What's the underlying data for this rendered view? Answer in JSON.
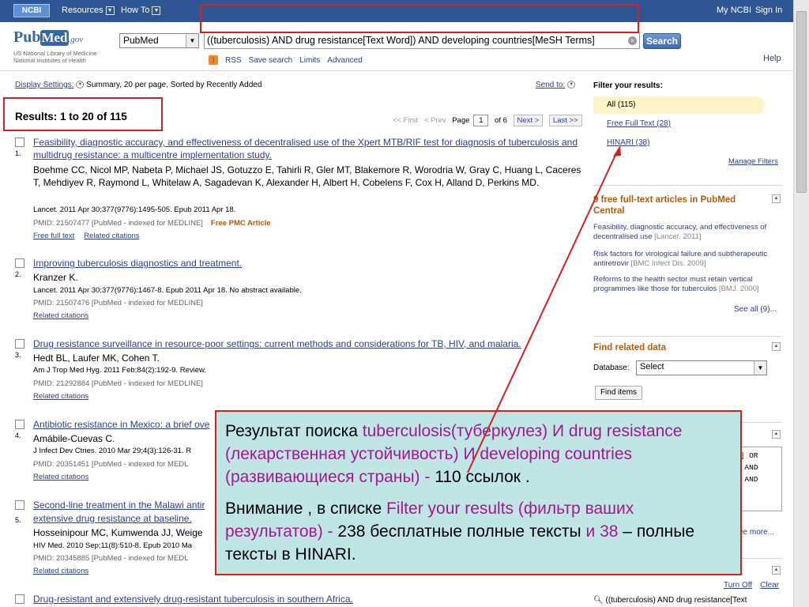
{
  "topbar": {
    "logo": "NCBI",
    "resources": "Resources",
    "howto": "How To",
    "my_ncbi": "My NCBI",
    "sign_in": "Sign In"
  },
  "header": {
    "logo_pub": "Pub",
    "logo_med": "Med",
    "logo_gov": ".gov",
    "nlm_line1": "US National Library of Medicine",
    "nlm_line2": "National Institutes of Health",
    "db_value": "PubMed",
    "search_value": "((tuberculosis) AND drug resistance[Text Word]) AND developing countries[MeSH Terms]",
    "search_button": "Search",
    "links": [
      "RSS",
      "Save search",
      "Limits",
      "Advanced"
    ],
    "help": "Help"
  },
  "display": {
    "settings_label": "Display Settings:",
    "settings_value": "Summary, 20 per page, Sorted by Recently Added",
    "send_to": "Send to:"
  },
  "results": {
    "count": "Results: 1 to 20 of 115",
    "pager": {
      "first": "<< First",
      "prev": "< Prev",
      "page_label": "Page",
      "page_value": "1",
      "of": "of 6",
      "next": "Next >",
      "last": "Last >>"
    },
    "items": [
      {
        "num": "1.",
        "title": "Feasibility, diagnostic accuracy, and effectiveness of decentralised use of the Xpert MTB/RIF test for diagnosis of tuberculosis and multidrug resistance: a multicentre implementation study.",
        "authors": "Boehme CC, Nicol MP, Nabeta P, Michael JS, Gotuzzo E, Tahirli R, Gler MT, Blakemore R, Worodria W, Gray C, Huang L, Caceres T, Mehdiyev R, Raymond L, Whitelaw A, Sagadevan K, Alexander H, Albert H, Cobelens F, Cox H, Alland D, Perkins MD.",
        "source": "Lancet. 2011 Apr 30;377(9776):1495-505. Epub 2011 Apr 18.",
        "pmid": "PMID: 21507477 [PubMed - indexed for MEDLINE]",
        "pmc": "Free PMC Article",
        "links": [
          "Free full text",
          "Related citations"
        ]
      },
      {
        "num": "2.",
        "title": "Improving tuberculosis diagnostics and treatment.",
        "authors": "Kranzer K.",
        "source": "Lancet. 2011 Apr 30;377(9776):1467-8. Epub 2011 Apr 18. No abstract available.",
        "pmid": "PMID: 21507476 [PubMed - indexed for MEDLINE]",
        "links": [
          "Related citations"
        ]
      },
      {
        "num": "3.",
        "title": "Drug resistance surveillance in resource-poor settings: current methods and considerations for TB, HIV, and malaria.",
        "authors": "Hedt BL, Laufer MK, Cohen T.",
        "source": "Am J Trop Med Hyg. 2011 Feb;84(2):192-9. Review.",
        "pmid": "PMID: 21292884 [PubMed - indexed for MEDLINE]",
        "links": [
          "Related citations"
        ]
      },
      {
        "num": "4.",
        "title": "Antibiotic resistance in Mexico: a brief ove",
        "authors": "Amábile-Cuevas C.",
        "source": "J Infect Dev Ctries. 2010 Mar 29;4(3):126-31. R",
        "pmid": "PMID: 20351451 [PubMed - indexed for MEDL",
        "links": [
          "Related citations"
        ]
      },
      {
        "num": "5.",
        "title": "Second-line treatment in the Malawi antir",
        "title2": "extensive drug resistance at baseline.",
        "authors": "Hosseinipour MC, Kumwenda JJ, Weige",
        "source": "HIV Med. 2010 Sep;11(8):510-8. Epub 2010 Ma",
        "pmid": "PMID: 20345885 [PubMed - indexed for MEDL",
        "links": [
          "Related citations"
        ]
      },
      {
        "num": "",
        "title": "Drug-resistant and extensively drug-resistant tuberculosis in southern Africa."
      }
    ]
  },
  "sidebar": {
    "filter_title": "Filter your results:",
    "filters": [
      "All (115)",
      "Free Full Text (28)",
      "HINARI (38)"
    ],
    "manage": "Manage Filters",
    "free_head": "9 free full-text articles in PubMed Central",
    "free_items": [
      {
        "title": "Feasibility, diagnostic accuracy, and effectiveness of decentralised use",
        "journal": "[Lancet. 2011]"
      },
      {
        "title": "Risk factors for virological failure and subtherapeutic antiretrovir",
        "journal": "[BMC Infect Dis. 2009]"
      },
      {
        "title": "Reforms to the health sector must retain vertical programmes like those for tuberculos",
        "journal": "[BMJ. 2000]"
      }
    ],
    "see_all": "See all (9)...",
    "related_head": "Find related data",
    "db_label": "Database:",
    "db_value": "Select",
    "find_button": "Find items",
    "history_lines": [
      "s] OR",
      ") AND",
      ") AND",
      "H"
    ],
    "see_more": "ee more...",
    "turn_off": "Turn Off",
    "clear": "Clear",
    "recent_query": "((tuberculosis) AND drug resistance[Text"
  },
  "annotation": {
    "p1_a": "Результат поиска",
    "p1_b": "tuberculosis(туберкулез) И drug resistance (лекарственная устойчивость) И developing countries (развивающиеся страны)",
    "p1_c": "-",
    "p1_d": "110 ссылок .",
    "p2_a": "Внимание , в списке",
    "p2_b": "Filter your results (фильтр ваших результатов)",
    "p2_c": "-",
    "p2_d": "238 бесплатные полные тексты",
    "p2_e": "и 38",
    "p2_f": "–",
    "p2_g": "полные тексты в HINARI."
  },
  "colors": {
    "highlight": "#d12222",
    "annotation_bg": "#bfe5e5",
    "annotation_accent": "#a5178f",
    "link": "#2c3f94",
    "ncbi_bar": "#2f5694"
  }
}
